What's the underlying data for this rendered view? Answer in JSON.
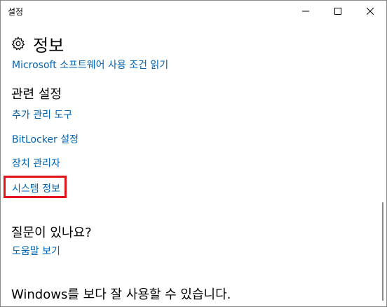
{
  "window": {
    "title": "설정"
  },
  "page": {
    "title": "정보",
    "top_link": "Microsoft 소프트웨어 사용 조건 읽기"
  },
  "related": {
    "heading": "관련 설정",
    "links": [
      "추가 관리 도구",
      "BitLocker 설정",
      "장치 관리자",
      "시스템 정보"
    ]
  },
  "question": {
    "heading": "질문이 있나요?",
    "link": "도움말 보기"
  },
  "bottom": {
    "text": "Windows를 보다 잘 사용할 수 있습니다."
  },
  "icons": {
    "header": "gear-icon",
    "minimize": "minimize-icon",
    "maximize": "maximize-icon",
    "close": "close-icon"
  },
  "colors": {
    "link": "#0063b1",
    "highlight": "#e1141c",
    "text": "#000000"
  }
}
